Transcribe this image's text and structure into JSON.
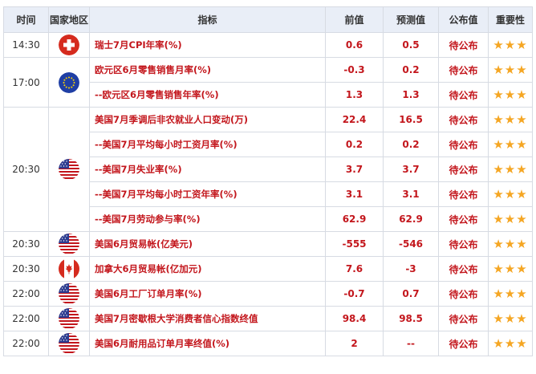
{
  "headers": {
    "time": "时间",
    "region": "国家地区",
    "indicator": "指标",
    "previous": "前值",
    "forecast": "预测值",
    "published": "公布值",
    "importance": "重要性"
  },
  "flags": {
    "switzerland": "swiss-flag",
    "euro": "eu-flag",
    "usa": "us-flag",
    "canada": "canada-flag"
  },
  "stars": "★★★",
  "rows": [
    {
      "time": "14:30",
      "indicator": "瑞士7月CPI年率(%)",
      "previous": "0.6",
      "forecast": "0.5",
      "published": "待公布"
    },
    {
      "time": "17:00",
      "indicator": "欧元区6月零售销售月率(%)",
      "previous": "-0.3",
      "forecast": "0.2",
      "published": "待公布"
    },
    {
      "indicator": "--欧元区6月零售销售年率(%)",
      "previous": "1.3",
      "forecast": "1.3",
      "published": "待公布"
    },
    {
      "time": "20:30",
      "indicator": "美国7月季调后非农就业人口变动(万)",
      "previous": "22.4",
      "forecast": "16.5",
      "published": "待公布"
    },
    {
      "indicator": "--美国7月平均每小时工资月率(%)",
      "previous": "0.2",
      "forecast": "0.2",
      "published": "待公布"
    },
    {
      "indicator": "--美国7月失业率(%)",
      "previous": "3.7",
      "forecast": "3.7",
      "published": "待公布"
    },
    {
      "indicator": "--美国7月平均每小时工资年率(%)",
      "previous": "3.1",
      "forecast": "3.1",
      "published": "待公布"
    },
    {
      "indicator": "--美国7月劳动参与率(%)",
      "previous": "62.9",
      "forecast": "62.9",
      "published": "待公布"
    },
    {
      "time": "20:30",
      "indicator": "美国6月贸易帐(亿美元)",
      "previous": "-555",
      "forecast": "-546",
      "published": "待公布"
    },
    {
      "time": "20:30",
      "indicator": "加拿大6月贸易帐(亿加元)",
      "previous": "7.6",
      "forecast": "-3",
      "published": "待公布"
    },
    {
      "time": "22:00",
      "indicator": "美国6月工厂订单月率(%)",
      "previous": "-0.7",
      "forecast": "0.7",
      "published": "待公布"
    },
    {
      "time": "22:00",
      "indicator": "美国7月密歇根大学消费者信心指数终值",
      "previous": "98.4",
      "forecast": "98.5",
      "published": "待公布"
    },
    {
      "time": "22:00",
      "indicator": "美国6月耐用品订单月率终值(%)",
      "previous": "2",
      "forecast": "--",
      "published": "待公布"
    }
  ]
}
